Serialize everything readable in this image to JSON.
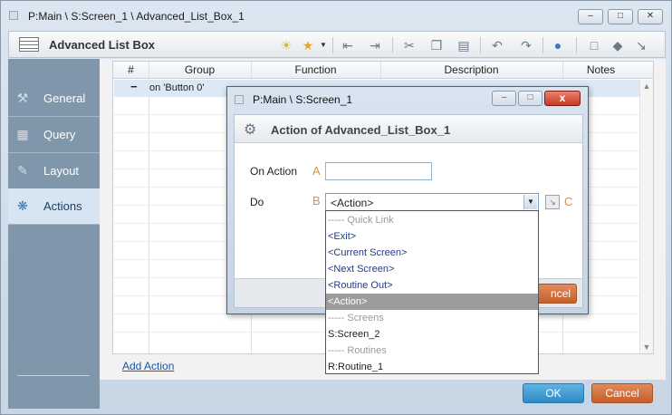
{
  "window": {
    "title": "P:Main \\ S:Screen_1 \\ Advanced_List_Box_1"
  },
  "toolbar": {
    "title": "Advanced List Box"
  },
  "nav": {
    "items": [
      {
        "label": "General",
        "icon": "wrench-icon"
      },
      {
        "label": "Query",
        "icon": "query-icon"
      },
      {
        "label": "Layout",
        "icon": "layout-icon"
      },
      {
        "label": "Actions",
        "icon": "actions-icon",
        "active": true
      }
    ]
  },
  "grid": {
    "columns": [
      "#",
      "Group",
      "Function",
      "Description",
      "Notes"
    ],
    "rows": [
      {
        "marker": "−",
        "text": "on 'Button 0'"
      }
    ]
  },
  "links": {
    "add_action": "Add Action"
  },
  "buttons": {
    "ok": "OK",
    "cancel": "Cancel"
  },
  "dialog": {
    "title": "P:Main \\ S:Screen_1",
    "header": "Action of Advanced_List_Box_1",
    "on_action_label": "On Action",
    "on_action_letter": "A",
    "on_action_value": "",
    "do_label": "Do",
    "do_letter": "B",
    "do_value": "<Action>",
    "expand_letter": "C",
    "cancel_partial": "ncel",
    "close": "x"
  },
  "dropdown": {
    "options": [
      {
        "label": "----- Quick Link",
        "kind": "muted"
      },
      {
        "label": "<Exit>",
        "kind": "link"
      },
      {
        "label": "<Current Screen>",
        "kind": "link"
      },
      {
        "label": "<Next Screen>",
        "kind": "link"
      },
      {
        "label": "<Routine Out>",
        "kind": "link"
      },
      {
        "label": "<Action>",
        "kind": "selected"
      },
      {
        "label": "----- Screens",
        "kind": "muted"
      },
      {
        "label": "S:Screen_2",
        "kind": "plain"
      },
      {
        "label": "----- Routines",
        "kind": "muted"
      },
      {
        "label": "R:Routine_1",
        "kind": "plain"
      }
    ]
  }
}
